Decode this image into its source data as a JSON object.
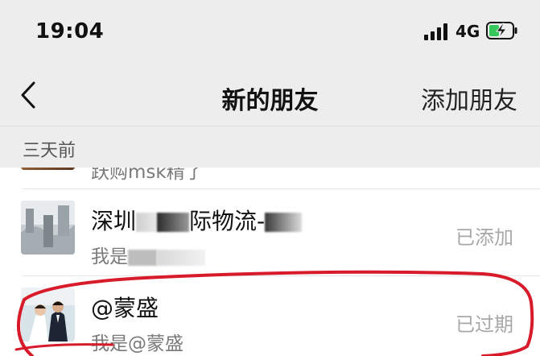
{
  "status_bar": {
    "time": "19:04",
    "network": "4G",
    "battery_icon": "battery-charging-icon",
    "signal_icon": "signal-bars-icon"
  },
  "nav": {
    "back_icon": "chevron-left-icon",
    "title": "新的朋友",
    "action": "添加朋友"
  },
  "section": {
    "label": "三天前"
  },
  "friends": [
    {
      "name": "",
      "message": "跃购msk精了",
      "status": ""
    },
    {
      "name_visible": "深圳",
      "name_visible_2": "际物流-",
      "message_visible": "我是",
      "status": "已添加"
    },
    {
      "name": "@蒙盛",
      "message": "我是@蒙盛",
      "status": "已过期"
    }
  ],
  "colors": {
    "background": "#ededed",
    "annotation": "#d81b2a",
    "status_text": "#a8a8a8",
    "battery_fill": "#35c759"
  }
}
